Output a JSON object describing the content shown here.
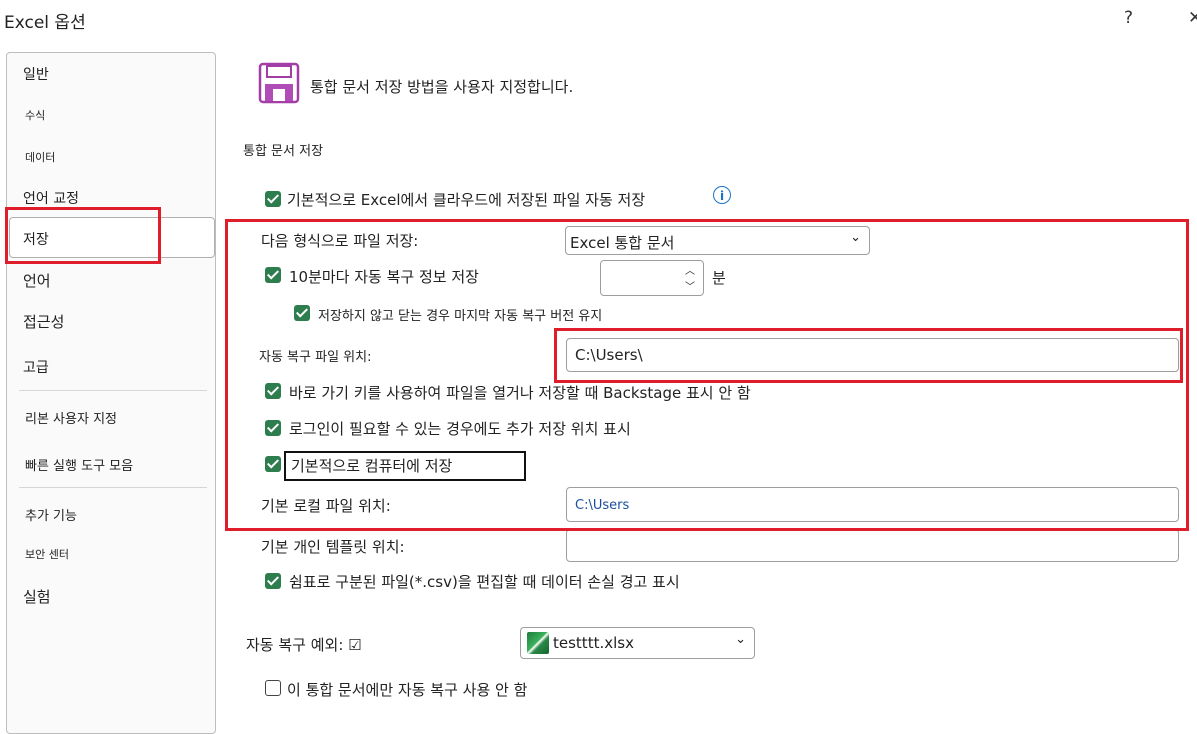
{
  "window": {
    "title": "Excel 옵션",
    "help": "?",
    "close": "✕"
  },
  "sidebar": {
    "items": [
      {
        "label": "일반"
      },
      {
        "label": "수식"
      },
      {
        "label": "데이터"
      },
      {
        "label": "언어 교정"
      },
      {
        "label": "저장",
        "selected": true
      },
      {
        "label": "언어"
      },
      {
        "label": "접근성"
      },
      {
        "label": "고급"
      },
      {
        "label": "리본 사용자 지정"
      },
      {
        "label": "빠른 실행 도구 모음"
      },
      {
        "label": "추가 기능"
      },
      {
        "label": "보안 센터"
      },
      {
        "label": "실험"
      }
    ]
  },
  "main": {
    "title": "통합 문서 저장 방법을 사용자 지정합니다.",
    "section": "통합 문서 저장",
    "autosave_default": {
      "label": "기본적으로 Excel에서 클라우드에 저장된 파일 자동 저장",
      "checked": true
    },
    "info_icon": "i",
    "save_format": {
      "label": "다음 형식으로 파일 저장:",
      "value": "Excel 통합 문서"
    },
    "autorecover": {
      "label": "10분마다 자동 복구 정보 저장",
      "checked": true,
      "minutes_value": "",
      "unit": "분"
    },
    "keep_last": {
      "label": "저장하지 않고 닫는 경우 마지막 자동 복구 버전 유지",
      "checked": true
    },
    "autorecover_location": {
      "label": "자동 복구 파일 위치:",
      "value": "C:\\Users\\"
    },
    "no_backstage": {
      "label": "바로 가기 키를 사용하여 파일을 열거나 저장할 때 Backstage 표시 안 함",
      "checked": true
    },
    "show_extra": {
      "label": "로그인이 필요할 수 있는 경우에도 추가 저장 위치 표시",
      "checked": true
    },
    "save_to_computer": {
      "label": "기본적으로 컴퓨터에 저장",
      "checked": true
    },
    "default_local": {
      "label": "기본 로컬 파일 위치:",
      "value": "C:\\Users"
    },
    "personal_templates": {
      "label": "기본 개인 템플릿 위치:",
      "value": ""
    },
    "csv_warning": {
      "label": "쉼표로 구분된 파일(*.csv)을 편집할 때 데이터 손실 경고 표시",
      "checked": true
    },
    "autorecover_exceptions": {
      "label": "자동 복구 예외: ☑",
      "file": "testttt.xlsx"
    },
    "disable_autorecover": {
      "label": "이 통합 문서에만 자동 복구 사용 안 함",
      "checked": false
    }
  },
  "colors": {
    "accent_checkbox": "#2e7d4f",
    "annotation_red": "#e01d2a",
    "link_blue": "#1a4fa0",
    "floppy_purple": "#a23ea6"
  }
}
